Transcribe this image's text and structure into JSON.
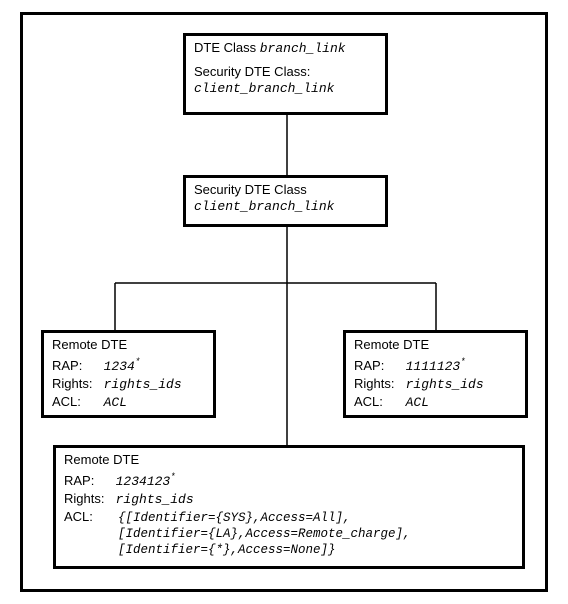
{
  "top_box": {
    "line1_label": "DTE Class",
    "line1_value": "branch_link",
    "line2_label": "Security DTE Class:",
    "line2_value": "client_branch_link"
  },
  "mid_box": {
    "line1_label": "Security DTE Class",
    "line1_value": "client_branch_link"
  },
  "left_dte": {
    "title": "Remote DTE",
    "rap_label": "RAP:",
    "rap_value": "1234",
    "rap_star": "*",
    "rights_label": "Rights:",
    "rights_value": "rights_ids",
    "acl_label": "ACL:",
    "acl_value": "ACL"
  },
  "right_dte": {
    "title": "Remote DTE",
    "rap_label": "RAP:",
    "rap_value": "1111123",
    "rap_star": "*",
    "rights_label": "Rights:",
    "rights_value": "rights_ids",
    "acl_label": "ACL:",
    "acl_value": "ACL"
  },
  "bottom_dte": {
    "title": "Remote DTE",
    "rap_label": "RAP:",
    "rap_value": "1234123",
    "rap_star": "*",
    "rights_label": "Rights:",
    "rights_value": "rights_ids",
    "acl_label": "ACL:",
    "acl_line1": "{[Identifier={SYS},Access=All],",
    "acl_line2": "[Identifier={LA},Access=Remote_charge],",
    "acl_line3": "[Identifier={*},Access=None]}"
  }
}
